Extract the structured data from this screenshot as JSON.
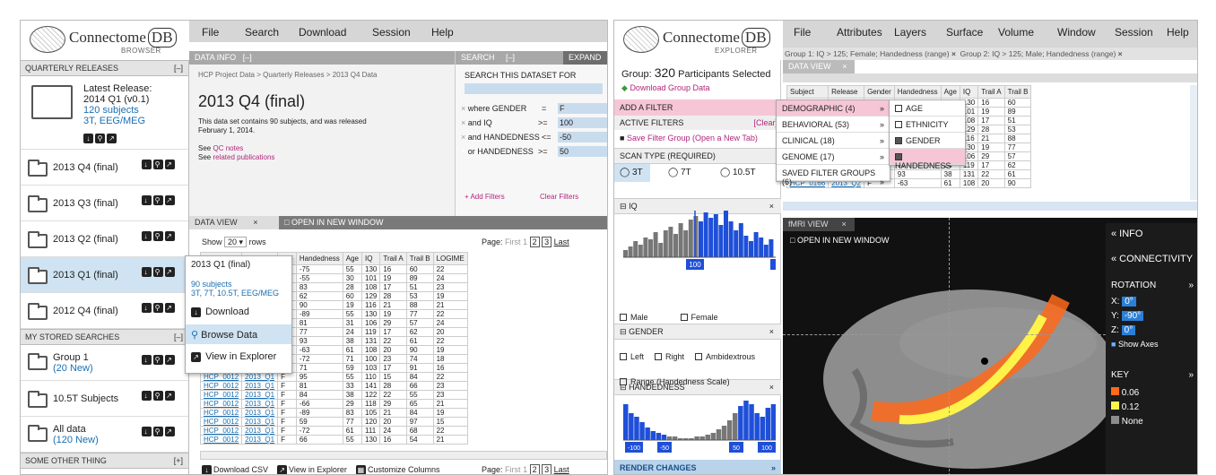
{
  "browser": {
    "logo_name": "Connectome",
    "logo_db": "DB",
    "logo_sub": "BROWSER",
    "menu": [
      "File",
      "Search",
      "Download",
      "Session",
      "Help"
    ],
    "quarterly_header": "QUARTERLY RELEASES",
    "collapse": "[–]",
    "latest": {
      "title": "Latest Release:",
      "name": "2014 Q1 (v0.1)",
      "subjects": "120 subjects",
      "modalities": "3T, EEG/MEG"
    },
    "releases": [
      "2013 Q4 (final)",
      "2013 Q3 (final)",
      "2013 Q2 (final)",
      "2013 Q1 (final)",
      "2012 Q4 (final)"
    ],
    "stored_header": "MY STORED SEARCHES",
    "stored": [
      {
        "name": "Group 1",
        "sub": "(20 New)"
      },
      {
        "name": "10.5T Subjects",
        "sub": ""
      },
      {
        "name": "All data",
        "sub": "(120 New)"
      }
    ],
    "other_header": "SOME OTHER THING",
    "expand": "[+]",
    "data_info": {
      "tab": "DATA INFO",
      "tab_ctrl": "[–]",
      "breadcrumb": "HCP Project Data > Quarterly Releases > 2013 Q4 Data",
      "title": "2013 Q4 (final)",
      "desc": "This data set contains 90 subjects, and was released February 1, 2014.",
      "see": "See ",
      "qc": "QC notes",
      "related": "related publications"
    },
    "search": {
      "tab": "SEARCH",
      "ctrl": "[–]",
      "expand": "EXPAND",
      "heading": "SEARCH THIS DATASET FOR",
      "rows": [
        {
          "label": "where GENDER",
          "op": "=",
          "value": "F"
        },
        {
          "label": "and IQ",
          "op": ">=",
          "value": "100"
        },
        {
          "label": "and HANDEDNESS",
          "op": "<=",
          "value": "-50"
        },
        {
          "label": "or HANDEDNESS",
          "op": ">=",
          "value": "50"
        }
      ],
      "add": "+ Add Filters",
      "clear": "Clear Filters"
    },
    "data_view": {
      "tab": "DATA VIEW",
      "open": "OPEN IN NEW WINDOW",
      "show": "Show",
      "rows_n": "20",
      "rows_label": "rows",
      "page_label": "Page:",
      "first": "First",
      "pages": [
        "1",
        "2",
        "3"
      ],
      "last": "Last",
      "columns": [
        "Subject",
        "Release",
        "M/F",
        "Handedness",
        "Age",
        "IQ",
        "Trail A",
        "Trail B",
        "LOGIME"
      ],
      "rows": [
        [
          "HCP_0012",
          "2013_Q1",
          "F",
          "-75",
          "55",
          "130",
          "16",
          "60",
          "22"
        ],
        [
          "HCP_0012",
          "2013_Q1",
          "F",
          "-55",
          "30",
          "101",
          "19",
          "89",
          "24"
        ],
        [
          "HCP_0012",
          "2013_Q1",
          "F",
          "83",
          "28",
          "108",
          "17",
          "51",
          "23"
        ],
        [
          "HCP_0012",
          "2013_Q2",
          "F",
          "62",
          "60",
          "129",
          "28",
          "53",
          "19"
        ],
        [
          "HCP_0012",
          "2013_Q2",
          "F",
          "90",
          "19",
          "116",
          "21",
          "88",
          "21"
        ],
        [
          "HCP_0012",
          "2013_Q2",
          "F",
          "-89",
          "55",
          "130",
          "19",
          "77",
          "22"
        ],
        [
          "HCP_0012",
          "2013_Q2",
          "F",
          "81",
          "31",
          "106",
          "29",
          "57",
          "24"
        ],
        [
          "HCP_0012",
          "2013_Q2",
          "F",
          "77",
          "24",
          "119",
          "17",
          "62",
          "20"
        ],
        [
          "HCP_0012",
          "2013_Q2",
          "F",
          "93",
          "38",
          "131",
          "22",
          "61",
          "22"
        ],
        [
          "HCP_0012",
          "2013_Q2",
          "F",
          "-63",
          "61",
          "108",
          "20",
          "90",
          "19"
        ],
        [
          "HCP_0012",
          "2013_Q1",
          "F",
          "-72",
          "71",
          "100",
          "23",
          "74",
          "18"
        ],
        [
          "HCP_0012",
          "2013_Q1",
          "F",
          "71",
          "59",
          "103",
          "17",
          "91",
          "16"
        ],
        [
          "HCP_0012",
          "2013_Q1",
          "F",
          "95",
          "55",
          "110",
          "15",
          "84",
          "22"
        ],
        [
          "HCP_0012",
          "2013_Q1",
          "F",
          "81",
          "33",
          "141",
          "28",
          "66",
          "23"
        ],
        [
          "HCP_0012",
          "2013_Q1",
          "F",
          "84",
          "38",
          "122",
          "22",
          "55",
          "23"
        ],
        [
          "HCP_0012",
          "2013_Q1",
          "F",
          "-66",
          "29",
          "118",
          "29",
          "65",
          "21"
        ],
        [
          "HCP_0012",
          "2013_Q1",
          "F",
          "-89",
          "83",
          "105",
          "21",
          "84",
          "19"
        ],
        [
          "HCP_0012",
          "2013_Q1",
          "F",
          "59",
          "77",
          "120",
          "20",
          "97",
          "15"
        ],
        [
          "HCP_0012",
          "2013_Q1",
          "F",
          "-72",
          "61",
          "111",
          "24",
          "68",
          "22"
        ],
        [
          "HCP_0012",
          "2013_Q1",
          "F",
          "66",
          "55",
          "130",
          "16",
          "54",
          "21"
        ]
      ],
      "download_csv": "Download CSV",
      "view_explorer": "View in Explorer",
      "customize": "Customize Columns"
    },
    "popup": {
      "title": "2013 Q1 (final)",
      "subjects": "90 subjects",
      "modalities": "3T, 7T, 10.5T, EEG/MEG",
      "download": "Download",
      "browse": "Browse Data",
      "view": "View in Explorer"
    }
  },
  "explorer": {
    "logo_sub": "EXPLORER",
    "menu": [
      "File",
      "Attributes",
      "Layers",
      "Surface",
      "Volume",
      "Window",
      "Session",
      "Help"
    ],
    "group_tabs": [
      "Group 1: IQ > 125; Female; Handedness (range)",
      "Group 2: IQ > 125; Male; Handedness (range)"
    ],
    "close": "×",
    "group_prefix": "Group:",
    "group_count": "320",
    "group_suffix": "Participants Selected",
    "download_group": "Download Group Data",
    "add_filter": "ADD A FILTER",
    "active_filters": "ACTIVE FILTERS",
    "clear": "[Clear]",
    "save_filter": "Save Filter Group",
    "open_new_tab": "(Open a New Tab)",
    "scan_type": "SCAN TYPE (REQUIRED)",
    "scan_options": [
      "3T",
      "7T",
      "10.5T"
    ],
    "iq": "IQ",
    "iq_marker": "100",
    "gender": "GENDER",
    "gender_options": [
      "Male",
      "Female"
    ],
    "handedness": "HANDEDNESS",
    "handedness_options": [
      "Left",
      "Right",
      "Ambidextrous"
    ],
    "range": "Range (Handedness Scale)",
    "range_markers": [
      "-100",
      "-50",
      "50",
      "100"
    ],
    "render": "RENDER CHANGES",
    "filter_menu": [
      "DEMOGRAPHIC (4)",
      "BEHAVIORAL (53)",
      "CLINICAL (18)",
      "GENOME (17)",
      "SAVED FILTER GROUPS (6)"
    ],
    "submenu": [
      "AGE",
      "ETHNICITY",
      "GENDER",
      "HANDEDNESS"
    ],
    "data_view": {
      "tab": "DATA VIEW",
      "columns": [
        "Subject",
        "Release",
        "Gender",
        "Handedness",
        "Age",
        "IQ",
        "Trail A",
        "Trail B"
      ],
      "rows": [
        [
          "",
          "",
          "",
          "75",
          "55",
          "130",
          "16",
          "60"
        ],
        [
          "",
          "",
          "",
          "55",
          "30",
          "101",
          "19",
          "89"
        ],
        [
          "",
          "",
          "",
          "3",
          "28",
          "108",
          "17",
          "51"
        ],
        [
          "",
          "",
          "",
          "2",
          "60",
          "129",
          "28",
          "53"
        ],
        [
          "",
          "",
          "",
          "0",
          "19",
          "116",
          "21",
          "88"
        ],
        [
          "",
          "Q2",
          "",
          "89",
          "55",
          "130",
          "19",
          "77"
        ],
        [
          "HCP_0141",
          "2013_Q2",
          "F",
          "81",
          "31",
          "106",
          "29",
          "57"
        ],
        [
          "HCP_0150",
          "2013_Q2",
          "F",
          "77",
          "24",
          "119",
          "17",
          "62"
        ],
        [
          "HCP_0150",
          "2013_Q2",
          "F",
          "93",
          "38",
          "131",
          "22",
          "61"
        ],
        [
          "HCP_0166",
          "2013_Q2",
          "F",
          "-63",
          "61",
          "108",
          "20",
          "90"
        ]
      ]
    },
    "fmri": {
      "tab": "fMRI VIEW",
      "open": "OPEN IN NEW WINDOW",
      "info": "«  INFO",
      "connectivity": "«  CONNECTIVITY",
      "rotation": "ROTATION",
      "x_label": "X:",
      "x": "0°",
      "y_label": "Y:",
      "y": "-90°",
      "z_label": "Z:",
      "z": "0°",
      "show_axes": "Show Axes",
      "key": "KEY",
      "key_items": [
        {
          "label": "0.06",
          "color": "#ff6a1a"
        },
        {
          "label": "0.12",
          "color": "#fff34a"
        },
        {
          "label": "None",
          "color": "#8c8c8c"
        }
      ],
      "chev": "»"
    }
  },
  "colors": {
    "accent_blue": "#1f4fd8",
    "pink": "#f6c6d6",
    "select_blue": "#cfe3f2"
  }
}
